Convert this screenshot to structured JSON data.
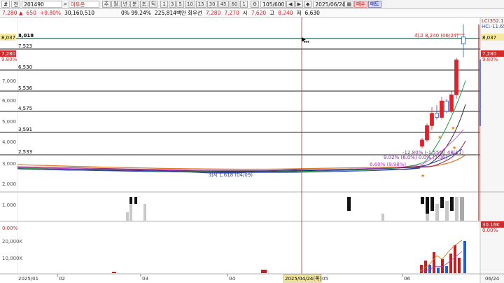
{
  "toolbar": {
    "hash_label": "#",
    "market_label": "전",
    "code": "201490",
    "company": "미투온",
    "view_buttons": [
      "주",
      "월",
      "년",
      "분",
      "초",
      "틱"
    ],
    "intervals": [
      "1",
      "3",
      "5",
      "10",
      "15",
      "30",
      "45",
      "60",
      "1"
    ],
    "page_count": "105/600",
    "date": "2025/06/24",
    "buy_label": "매수",
    "sell_label": "매도"
  },
  "quote": {
    "price": "7,280 ▲",
    "change": "650",
    "change_pct": "+9.80%",
    "volume": "30,160,510",
    "turnover_pct": "0% 99.24%",
    "trade_value": "225,814백만 회우선",
    "val_a": "7,280",
    "val_b": "7,270",
    "open_label": "시",
    "open": "7,620",
    "high_label": "고",
    "high": "8,240",
    "low_label": "저",
    "low": "6,630"
  },
  "left_tags": {
    "price_tag": "8,037",
    "current_tag": "7,280",
    "current_pct": "9.80%"
  },
  "right_panel": {
    "lc": "LC(352.17",
    "hc": "HC:-11.65",
    "price_tag": "8,037",
    "current_tag": "7,280",
    "current_pct": "9.80%",
    "vol_tag": "30.16K",
    "vol_pct": "0.00%"
  },
  "levels": [
    "8,018",
    "7,523",
    "6,530",
    "5,536",
    "4,575",
    "3,591",
    "2,533"
  ],
  "y_axis": [
    "7,000",
    "6,000",
    "5,000",
    "4,000",
    "3,000",
    "2,000",
    "1,000"
  ],
  "vol_axis": [
    "0.00%",
    "20,000K",
    "10,000K"
  ],
  "x_axis": [
    "2025/01",
    "02",
    "03",
    "04",
    "05",
    "06",
    "06/24"
  ],
  "crosshair_date": "2025/04/24(목)",
  "annotations": {
    "high": "최고 8,240 (06/24)",
    "low": "최저 1,618 (04/09)",
    "ma1": "-12.80% (-1,55%) 48(11)",
    "ma2": "9.02% (6.0%) 0.0% (7.06)",
    "ma3": "6.60% (9.98%)"
  },
  "chart_data": {
    "type": "candlestick",
    "x_range": [
      "2025/01",
      "2025/06/24"
    ],
    "y_range": [
      0,
      8500
    ],
    "candles": [
      {
        "open": 2300,
        "high": 2700,
        "low": 2200,
        "close": 2600
      },
      {
        "open": 2600,
        "high": 3400,
        "low": 2500,
        "close": 3300
      },
      {
        "open": 3300,
        "high": 4200,
        "low": 3100,
        "close": 3900
      },
      {
        "open": 3900,
        "high": 4300,
        "low": 3600,
        "close": 3700
      },
      {
        "open": 3700,
        "high": 4700,
        "low": 3600,
        "close": 4500
      },
      {
        "open": 4500,
        "high": 4600,
        "low": 3900,
        "close": 4000
      },
      {
        "open": 4000,
        "high": 5000,
        "low": 3900,
        "close": 4800
      },
      {
        "open": 4800,
        "high": 6600,
        "low": 4600,
        "close": 6500
      },
      {
        "open": 7620,
        "high": 8240,
        "low": 6630,
        "close": 7280
      }
    ]
  },
  "colors": {
    "up": "#e0202a",
    "down": "#1f5fd0",
    "level_line": "#000000",
    "crosshair": "#c03030"
  }
}
